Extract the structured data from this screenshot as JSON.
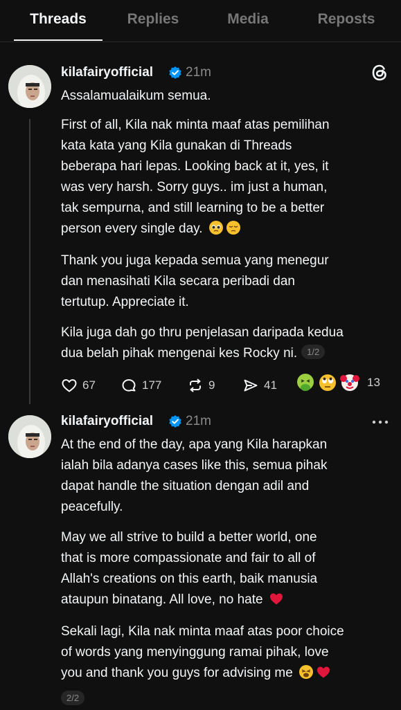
{
  "tabs": [
    {
      "label": "Threads",
      "active": true
    },
    {
      "label": "Replies",
      "active": false
    },
    {
      "label": "Media",
      "active": false
    },
    {
      "label": "Reposts",
      "active": false
    }
  ],
  "posts": [
    {
      "username": "kilafairyofficial",
      "verified": true,
      "time": "21m",
      "paragraphs": [
        [
          "Assalamualaikum semua."
        ],
        [
          "First of all, Kila nak minta maaf atas pemilihan",
          "kata kata yang Kila gunakan di Threads",
          "beberapa hari lepas. Looking back at it, yes, it",
          "was very harsh. Sorry guys.. im just a human,",
          "tak sempurna, and still learning to be a better",
          "person every single day."
        ],
        [
          "Thank you juga kepada semua yang menegur",
          "dan menasihati Kila secara peribadi dan",
          "tertutup. Appreciate it."
        ],
        [
          "Kila juga dah go thru penjelasan daripada kedua",
          "dua belah pihak mengenai kes Rocky ni."
        ]
      ],
      "page_badge": "1/2",
      "actions": {
        "likes": "67",
        "comments": "177",
        "reposts": "9",
        "shares": "41",
        "reactions_count": "13"
      }
    },
    {
      "username": "kilafairyofficial",
      "verified": true,
      "time": "21m",
      "paragraphs": [
        [
          "At the end of the day, apa yang Kila harapkan",
          "ialah bila adanya cases like this, semua pihak",
          "dapat handle the situation dengan adil and",
          "peacefully."
        ],
        [
          "May we all strive to build a better world, one",
          "that is more compassionate and fair to all of",
          "Allah's creations on this earth, baik manusia",
          "ataupun binatang. All love, no hate"
        ],
        [
          "Sekali lagi, Kila nak minta maaf atas poor choice",
          "of words yang menyinggung ramai pihak, love",
          "you and thank you guys for advising me"
        ]
      ],
      "page_badge": "2/2"
    }
  ],
  "icons": {
    "verified": "verified-badge-icon",
    "threads_logo": "threads-logo-icon",
    "like": "heart-icon",
    "comment": "comment-icon",
    "repost": "repost-icon",
    "share": "send-icon",
    "more": "more-icon",
    "reaction_emojis": [
      "nauseated-face-emoji",
      "eye-roll-emoji",
      "clown-face-emoji"
    ],
    "emojis_post1": [
      "pleading-face-emoji",
      "pensive-face-emoji"
    ],
    "emoji_post2_p2": "red-heart-emoji",
    "emojis_post2_p3": [
      "weary-face-emoji",
      "red-heart-emoji"
    ]
  },
  "colors": {
    "background": "#101010",
    "text": "#f3f5f7",
    "muted": "#8a8a8a",
    "verified": "#0095f6",
    "heart": "#e0163a",
    "emoji": "#f7c12d"
  }
}
